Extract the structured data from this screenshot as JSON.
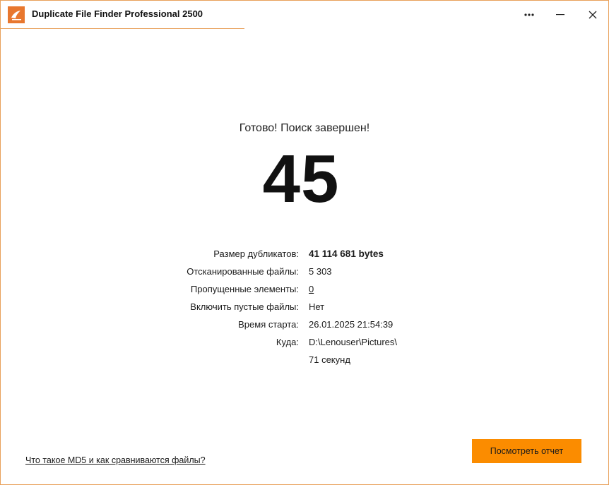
{
  "window": {
    "title": "Duplicate File Finder Professional 2500",
    "accent_color": "#fb8c00",
    "border_color": "#e8a05a"
  },
  "titlebar_buttons": {
    "more": "•••",
    "minimize": "—",
    "close": "✕"
  },
  "result": {
    "headline": "Готово! Поиск завершен!",
    "duplicate_count": "45"
  },
  "stats": [
    {
      "label": "Размер дубликатов:",
      "value": "41 114 681 bytes"
    },
    {
      "label": "Отсканированные файлы:",
      "value": "5 303"
    },
    {
      "label": "Пропущенные элементы:",
      "value": "0"
    },
    {
      "label": "Включить пустые файлы:",
      "value": "Нет"
    },
    {
      "label": "Время старта:",
      "value": "26.01.2025 21:54:39"
    },
    {
      "label": "Куда:",
      "value": "D:\\Lenouser\\Pictures\\"
    },
    {
      "label": "",
      "value": "71 секунд"
    }
  ],
  "footer": {
    "help_link": "Что такое MD5 и как сравниваются файлы?",
    "report_button": "Посмотреть отчет"
  }
}
